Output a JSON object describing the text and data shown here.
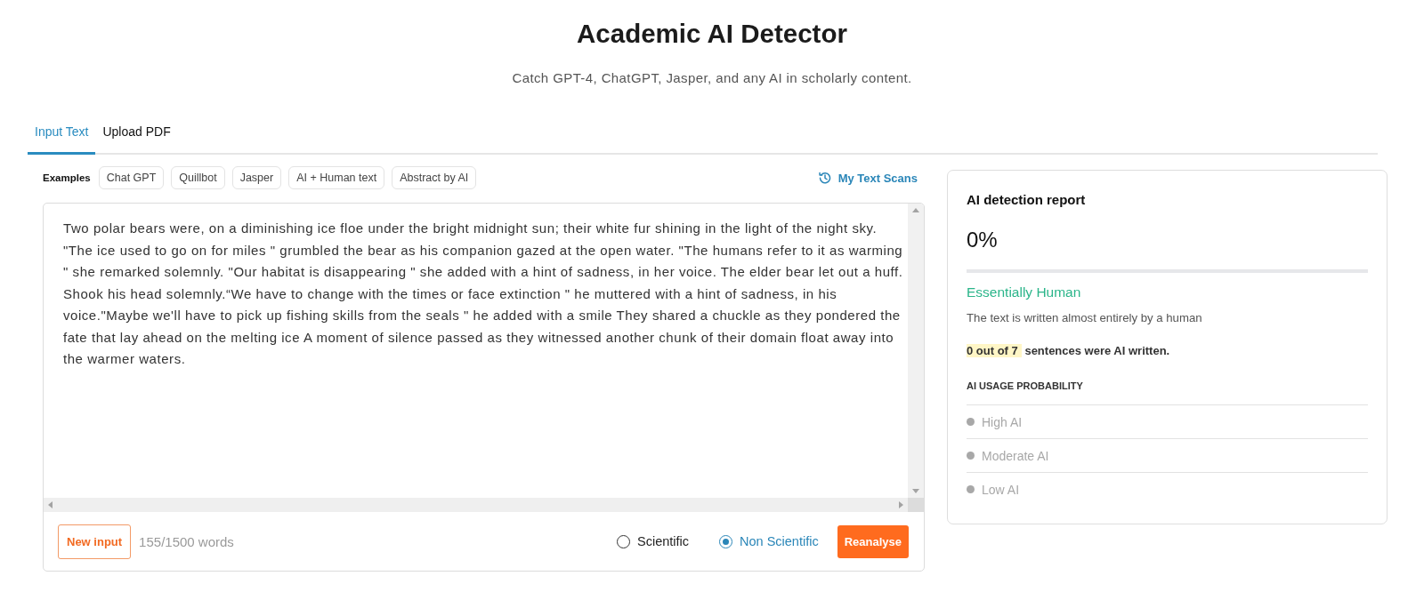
{
  "header": {
    "title": "Academic AI Detector",
    "subtitle": "Catch GPT-4, ChatGPT, Jasper, and any AI in scholarly content."
  },
  "tabs": [
    {
      "label": "Input Text",
      "selected": true
    },
    {
      "label": "Upload PDF",
      "selected": false
    }
  ],
  "examples": {
    "label": "Examples",
    "items": [
      "Chat GPT",
      "Quillbot",
      "Jasper",
      "AI + Human text",
      "Abstract by AI"
    ]
  },
  "history_link": {
    "label": "My Text Scans"
  },
  "editor": {
    "value": "Two polar bears were, on a diminishing ice floe under the bright midnight sun; their white fur shining in the light of the night sky. \"The ice used to go on for miles \" grumbled the bear as his companion gazed at the open water. \"The humans refer to it as warming \" she remarked solemnly. \"Our habitat is disappearing \" she added with a hint of sadness, in her voice. The elder bear let out a huff. Shook his head solemnly.“We have to change with the times or face extinction \" he muttered with a hint of sadness, in his voice.\"Maybe we'll have to pick up fishing skills from the seals \" he added with a smile They shared a chuckle as they pondered the fate that lay ahead on the melting ice A moment of silence passed as they witnessed another chunk of their domain float away into the warmer waters.",
    "new_input_button": "New input",
    "word_count": "155/1500 words",
    "modes": [
      {
        "label": "Scientific",
        "selected": false
      },
      {
        "label": "Non Scientific",
        "selected": true
      }
    ],
    "reanalyse_button": "Reanalyse"
  },
  "report": {
    "title": "AI detection report",
    "score": "0%",
    "level": 0,
    "verdict": "Essentially Human",
    "description": "The text is written almost entirely by a human",
    "summary": {
      "highlight": "0 out of 7",
      "text": "sentences were AI written."
    },
    "probability": {
      "heading": "AI USAGE PROBABILITY",
      "items": [
        {
          "label": "High AI",
          "active": false
        },
        {
          "label": "Moderate AI",
          "active": false
        },
        {
          "label": "Low AI",
          "active": false
        }
      ]
    }
  }
}
